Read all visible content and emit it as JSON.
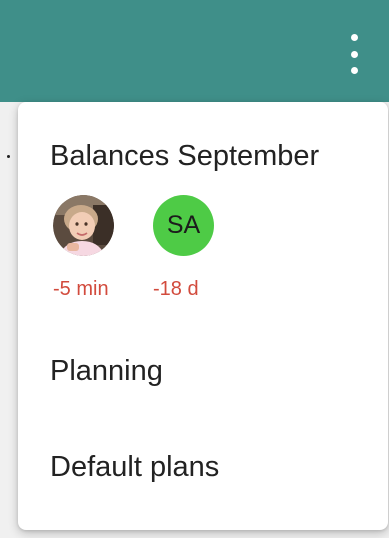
{
  "app_bar": {
    "background": "#3f8f89",
    "menu_icon": "more-vertical-icon"
  },
  "menu": {
    "title": "Balances September",
    "balances": [
      {
        "avatar_type": "photo",
        "avatar_icon": "child-photo-avatar",
        "value": "-5 min"
      },
      {
        "avatar_type": "initials",
        "initials": "SA",
        "avatar_color": "#4ecb46",
        "value": "-18 d"
      }
    ],
    "items": [
      {
        "label": "Planning"
      },
      {
        "label": "Default plans"
      }
    ],
    "negative_color": "#d24b3d"
  }
}
